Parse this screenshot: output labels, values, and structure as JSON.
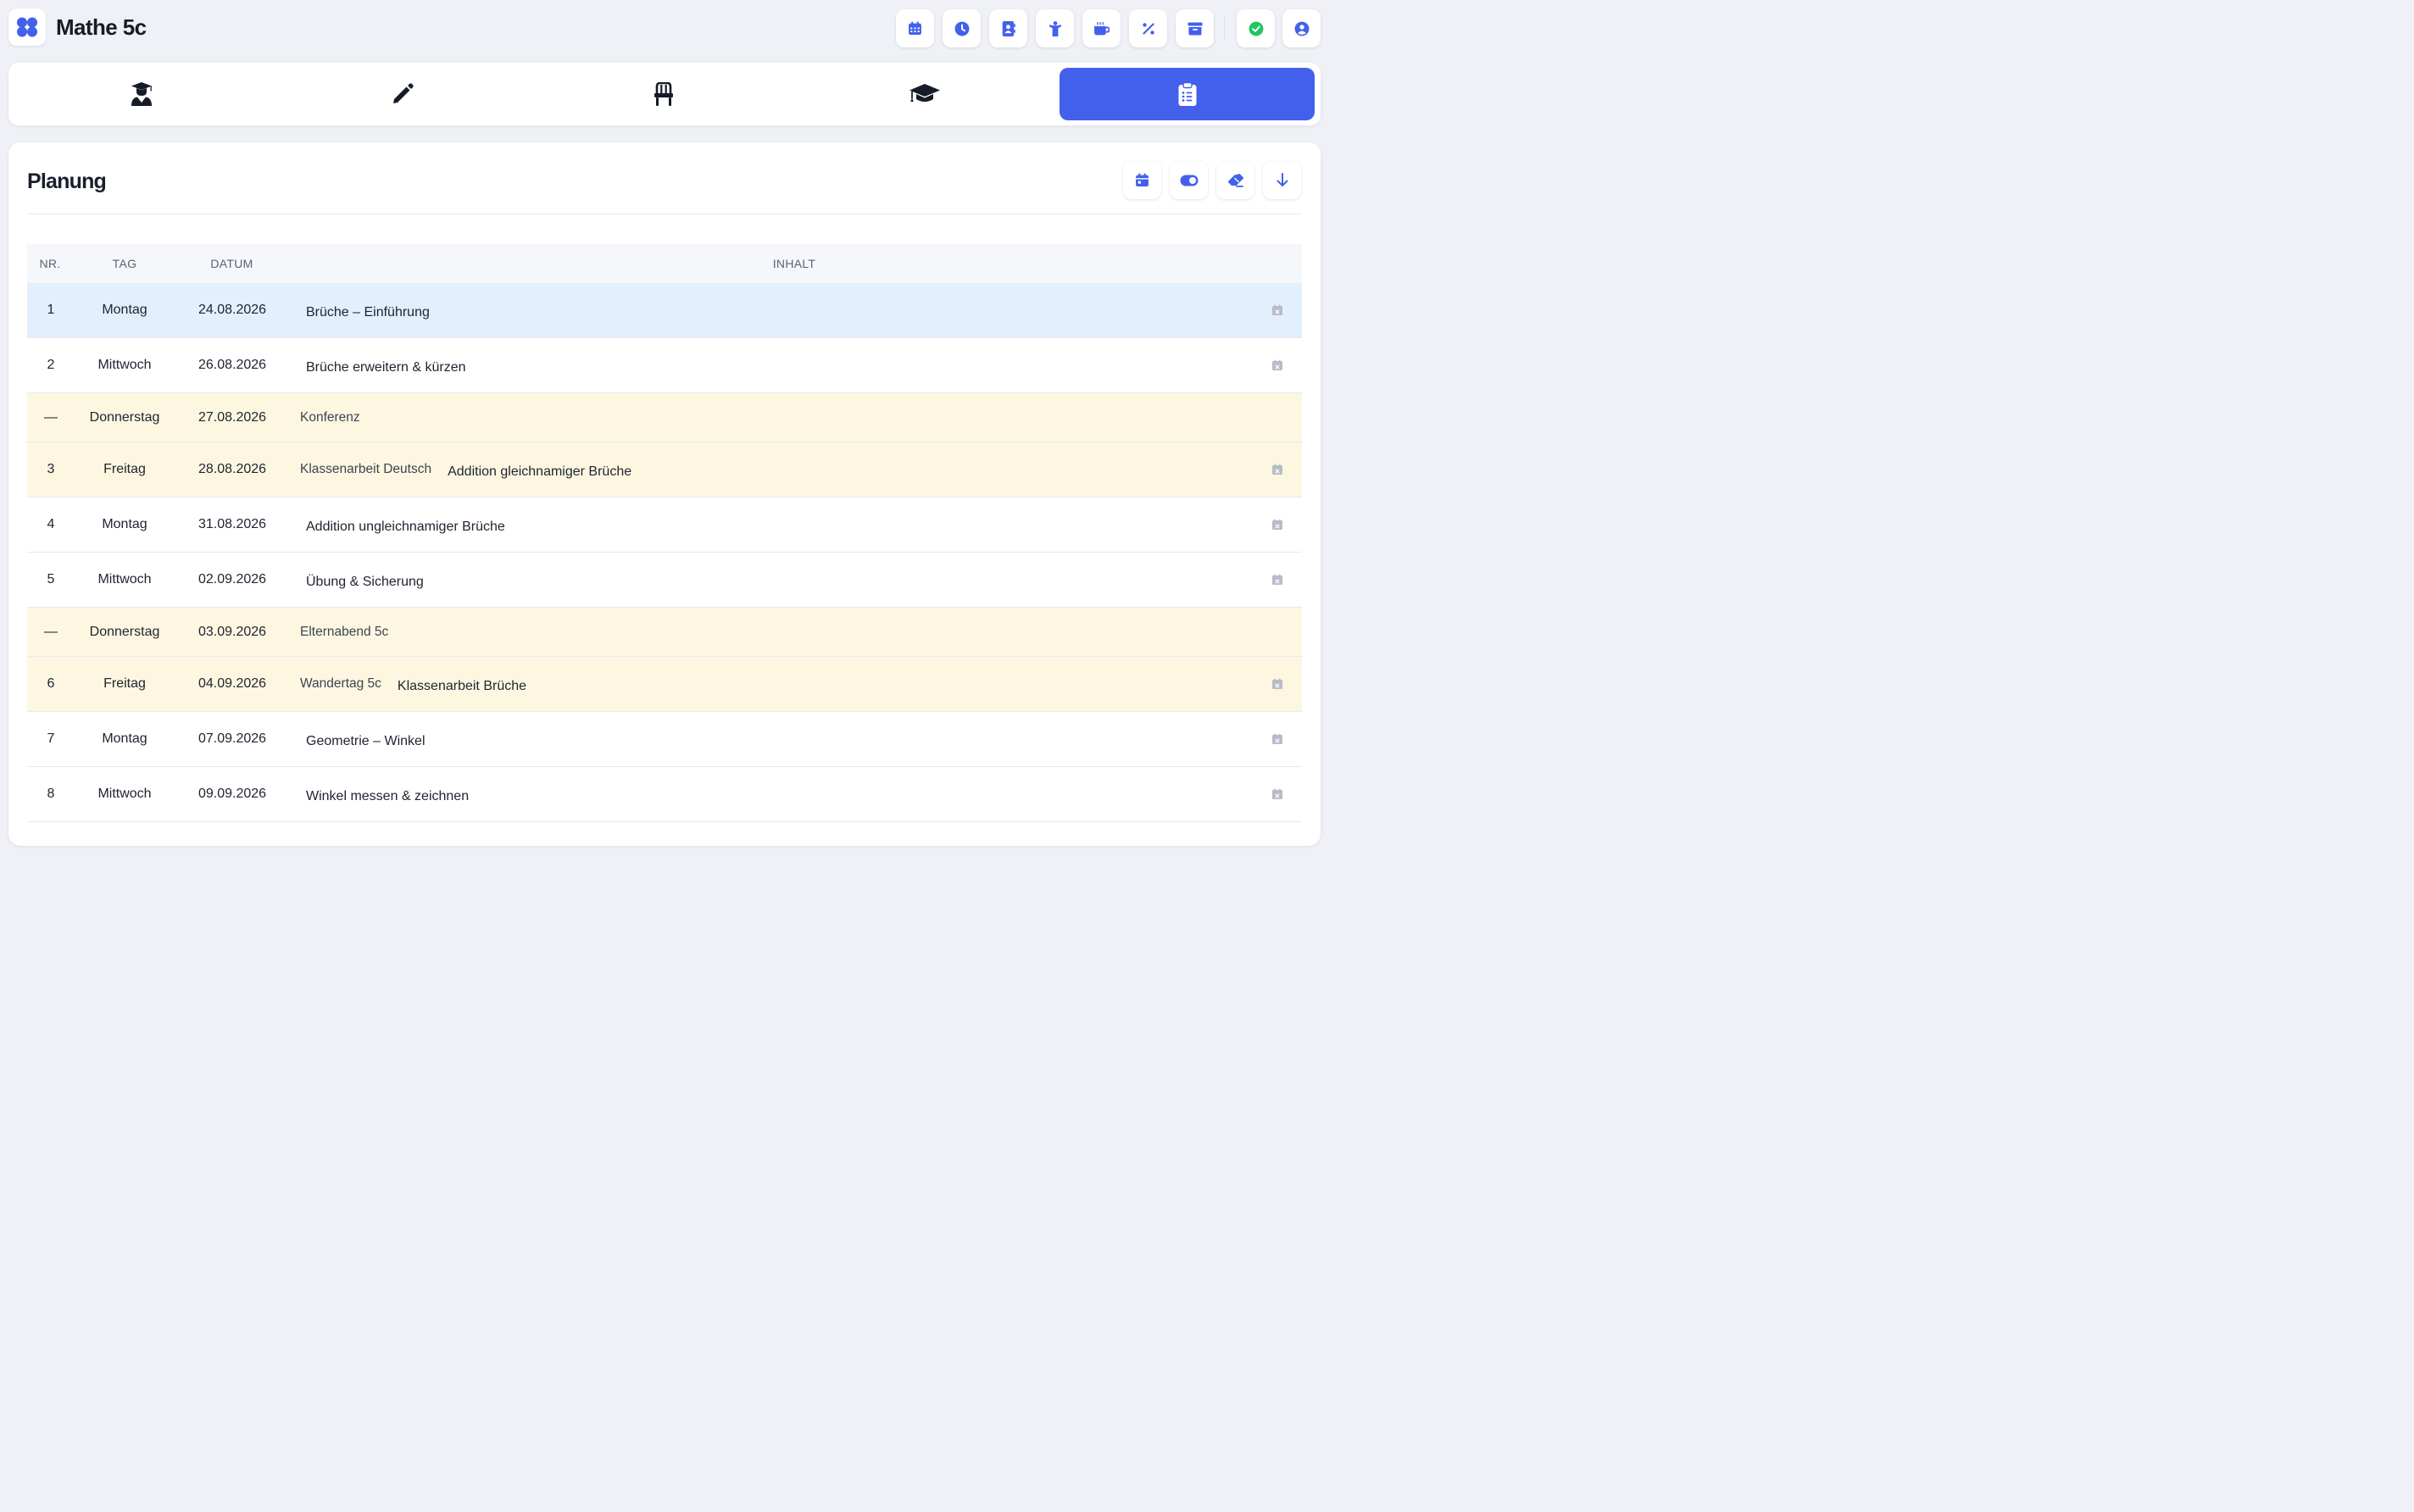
{
  "app": {
    "title": "Mathe 5c",
    "logo_icon": "four-dots-logo-icon",
    "accent_color": "#4360ec"
  },
  "toolbar": {
    "icons": [
      "calendar-icon",
      "clock-icon",
      "contacts-icon",
      "person-icon",
      "coffee-icon",
      "percent-icon",
      "archive-icon",
      "check-circle-icon",
      "user-circle-icon"
    ],
    "status_color": "#22c55e"
  },
  "tabs": {
    "icons": [
      "teacher-icon",
      "pencil-icon",
      "chair-icon",
      "graduation-cap-icon",
      "clipboard-list-icon"
    ],
    "active_index": 4
  },
  "planning": {
    "title": "Planung",
    "actions": [
      "calendar-icon",
      "toggle-icon",
      "eraser-icon",
      "download-arrow-icon"
    ],
    "columns": {
      "nr": "NR.",
      "tag": "TAG",
      "datum": "DATUM",
      "inhalt": "INHALT"
    },
    "rows": [
      {
        "nr": "1",
        "tag": "Montag",
        "datum": "24.08.2026",
        "event": "",
        "content": "Brüche – Einführung",
        "kind": "lesson",
        "selected": true
      },
      {
        "nr": "2",
        "tag": "Mittwoch",
        "datum": "26.08.2026",
        "event": "",
        "content": "Brüche erweitern & kürzen",
        "kind": "lesson"
      },
      {
        "nr": "—",
        "tag": "Donnerstag",
        "datum": "27.08.2026",
        "event": "Konferenz",
        "content": "",
        "kind": "event"
      },
      {
        "nr": "3",
        "tag": "Freitag",
        "datum": "28.08.2026",
        "event": "Klassenarbeit Deutsch",
        "content": "Addition gleichnamiger Brüche",
        "kind": "evtday"
      },
      {
        "nr": "4",
        "tag": "Montag",
        "datum": "31.08.2026",
        "event": "",
        "content": "Addition ungleichnamiger Brüche",
        "kind": "lesson"
      },
      {
        "nr": "5",
        "tag": "Mittwoch",
        "datum": "02.09.2026",
        "event": "",
        "content": "Übung & Sicherung",
        "kind": "lesson"
      },
      {
        "nr": "—",
        "tag": "Donnerstag",
        "datum": "03.09.2026",
        "event": "Elternabend 5c",
        "content": "",
        "kind": "event"
      },
      {
        "nr": "6",
        "tag": "Freitag",
        "datum": "04.09.2026",
        "event": "Wandertag 5c",
        "content": "Klassenarbeit Brüche",
        "kind": "evtday"
      },
      {
        "nr": "7",
        "tag": "Montag",
        "datum": "07.09.2026",
        "event": "",
        "content": "Geometrie – Winkel",
        "kind": "lesson"
      },
      {
        "nr": "8",
        "tag": "Mittwoch",
        "datum": "09.09.2026",
        "event": "",
        "content": "Winkel messen & zeichnen",
        "kind": "lesson"
      }
    ]
  }
}
